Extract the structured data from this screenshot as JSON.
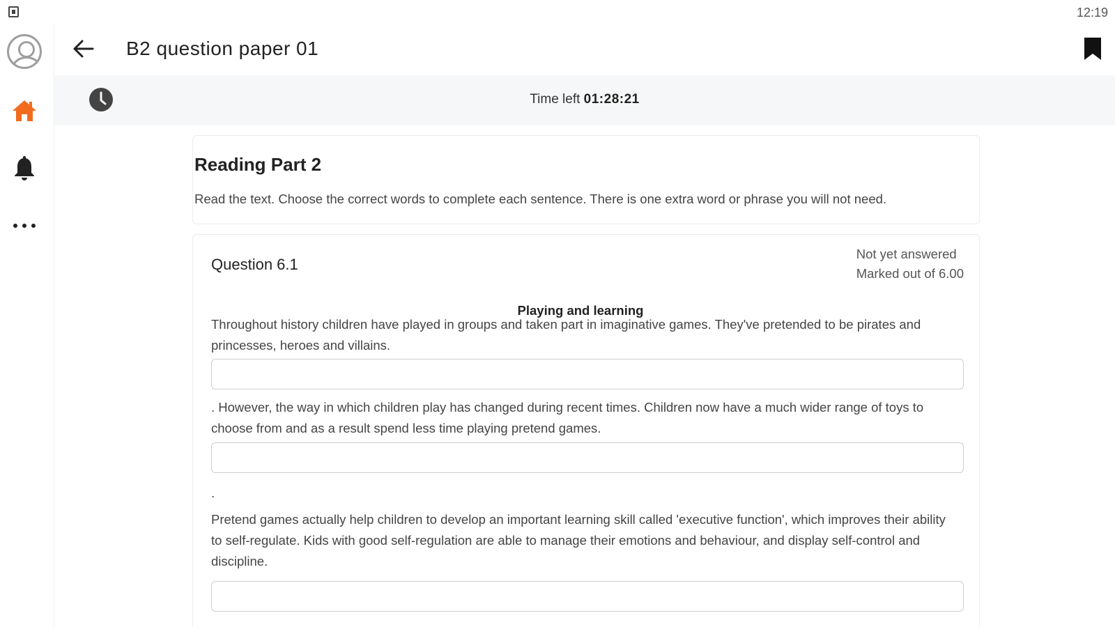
{
  "status_bar": {
    "time": "12:19"
  },
  "rail": {
    "items": [
      {
        "name": "profile",
        "icon": "avatar-icon"
      },
      {
        "name": "home",
        "icon": "home-icon",
        "color": "#f26b1d"
      },
      {
        "name": "notifications",
        "icon": "bell-icon"
      },
      {
        "name": "more",
        "icon": "more-horizontal-icon"
      }
    ]
  },
  "appbar": {
    "title": "B2 question paper 01"
  },
  "timer": {
    "label": "Time left",
    "value": "01:28:21"
  },
  "section": {
    "title": "Reading Part 2",
    "instruction": "Read the text. Choose the correct words to complete each sentence. There is one extra word or phrase you will not need."
  },
  "question": {
    "label": "Question 6.1",
    "status": "Not yet answered",
    "marks": "Marked out of 6.00",
    "passage_title": "Playing and learning",
    "paragraphs": [
      "Throughout history children have played in groups and taken part in imaginative games. They've pretended to be pirates and princesses, heroes and villains.",
      ". However, the way in which children play has changed during recent times. Children now have a much wider range of toys to choose from and as a result spend less time playing pretend games.",
      ".",
      "Pretend games actually help children to develop an important learning skill called 'executive function', which improves their ability to self-regulate. Kids with good self-regulation are able to manage their emotions and behaviour, and display self-control and discipline."
    ],
    "answers": [
      "",
      "",
      ""
    ]
  },
  "colors": {
    "accent": "#f26b1d",
    "timer_bg": "#f6f7f8"
  }
}
